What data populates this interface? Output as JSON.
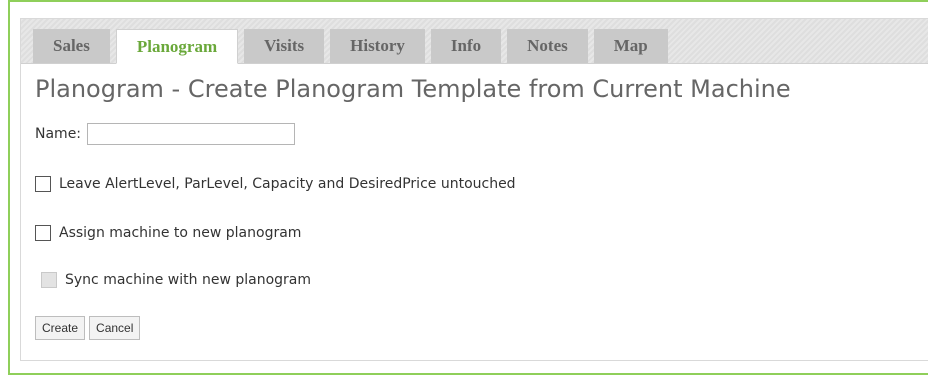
{
  "tabs": [
    {
      "label": "Sales",
      "active": false
    },
    {
      "label": "Planogram",
      "active": true
    },
    {
      "label": "Visits",
      "active": false
    },
    {
      "label": "History",
      "active": false
    },
    {
      "label": "Info",
      "active": false
    },
    {
      "label": "Notes",
      "active": false
    },
    {
      "label": "Map",
      "active": false
    }
  ],
  "page": {
    "title": "Planogram - Create Planogram Template from Current Machine"
  },
  "form": {
    "name_label": "Name:",
    "name_value": "",
    "options": [
      {
        "label": "Leave AlertLevel, ParLevel, Capacity and DesiredPrice untouched",
        "checked": false,
        "enabled": true
      },
      {
        "label": "Assign machine to new planogram",
        "checked": false,
        "enabled": true
      },
      {
        "label": "Sync machine with new planogram",
        "checked": false,
        "enabled": false
      }
    ],
    "create_label": "Create",
    "cancel_label": "Cancel"
  },
  "colors": {
    "frame_border": "#8fcf5a",
    "active_tab_text": "#6aa83a",
    "inactive_tab_bg": "#c9c9c9",
    "inactive_tab_text": "#666666"
  }
}
